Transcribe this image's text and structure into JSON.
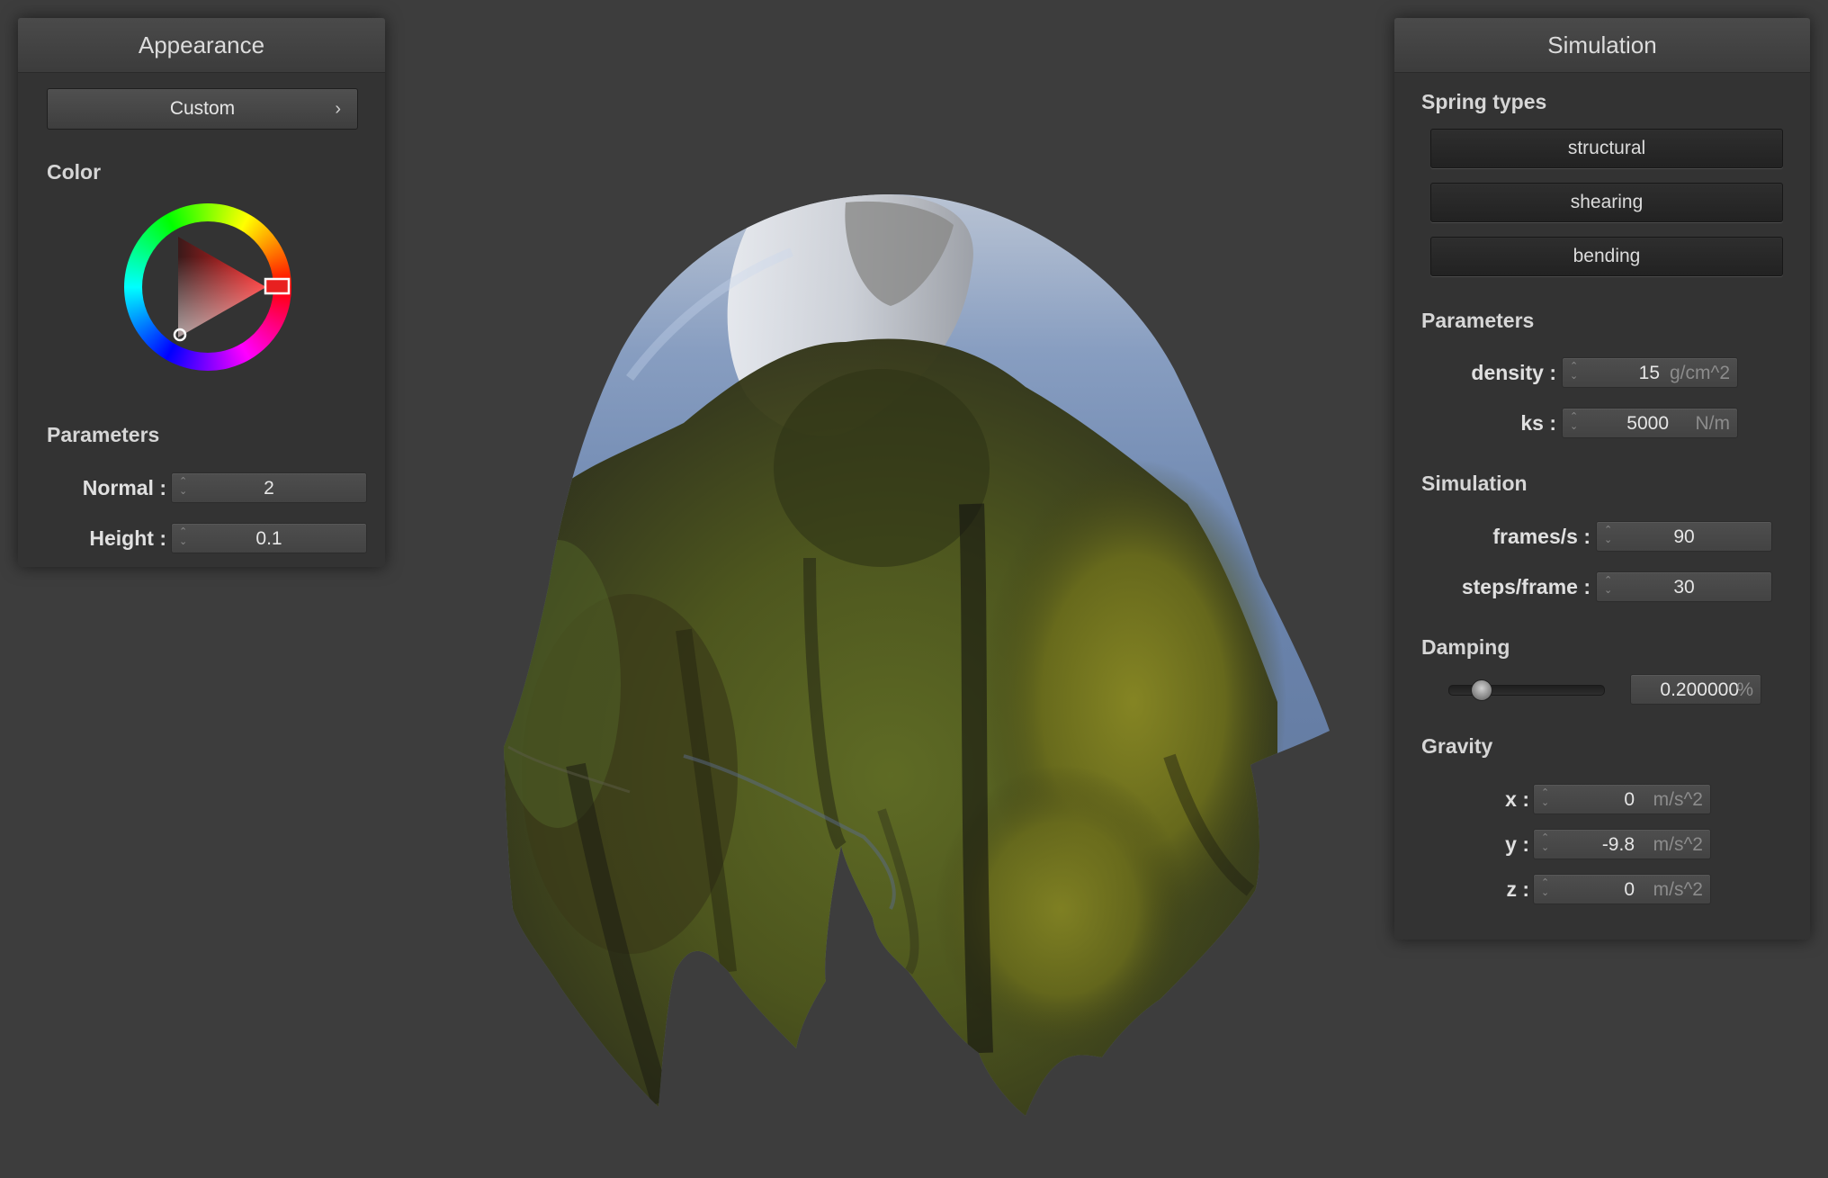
{
  "appearance": {
    "title": "Appearance",
    "preset": "Custom",
    "color_label": "Color",
    "selected_color": "#e82020",
    "parameters_label": "Parameters",
    "normal_label": "Normal :",
    "normal_value": "2",
    "height_label": "Height :",
    "height_value": "0.1"
  },
  "simulation_panel": {
    "title": "Simulation",
    "spring_types_label": "Spring types",
    "spring_types": [
      "structural",
      "shearing",
      "bending"
    ],
    "parameters_label": "Parameters",
    "density_label": "density :",
    "density_value": "15",
    "density_unit": "g/cm^2",
    "ks_label": "ks :",
    "ks_value": "5000",
    "ks_unit": "N/m",
    "simulation_label": "Simulation",
    "fps_label": "frames/s :",
    "fps_value": "90",
    "steps_label": "steps/frame :",
    "steps_value": "30",
    "damping_label": "Damping",
    "damping_value": "0.200000",
    "damping_unit": "%",
    "damping_fraction": 0.2,
    "gravity_label": "Gravity",
    "gx_label": "x :",
    "gx_value": "0",
    "gy_label": "y :",
    "gy_value": "-9.8",
    "gz_label": "z :",
    "gz_value": "0",
    "gravity_unit": "m/s^2"
  },
  "colors": {
    "background": "#3d3d3d",
    "panel": "#333333"
  }
}
